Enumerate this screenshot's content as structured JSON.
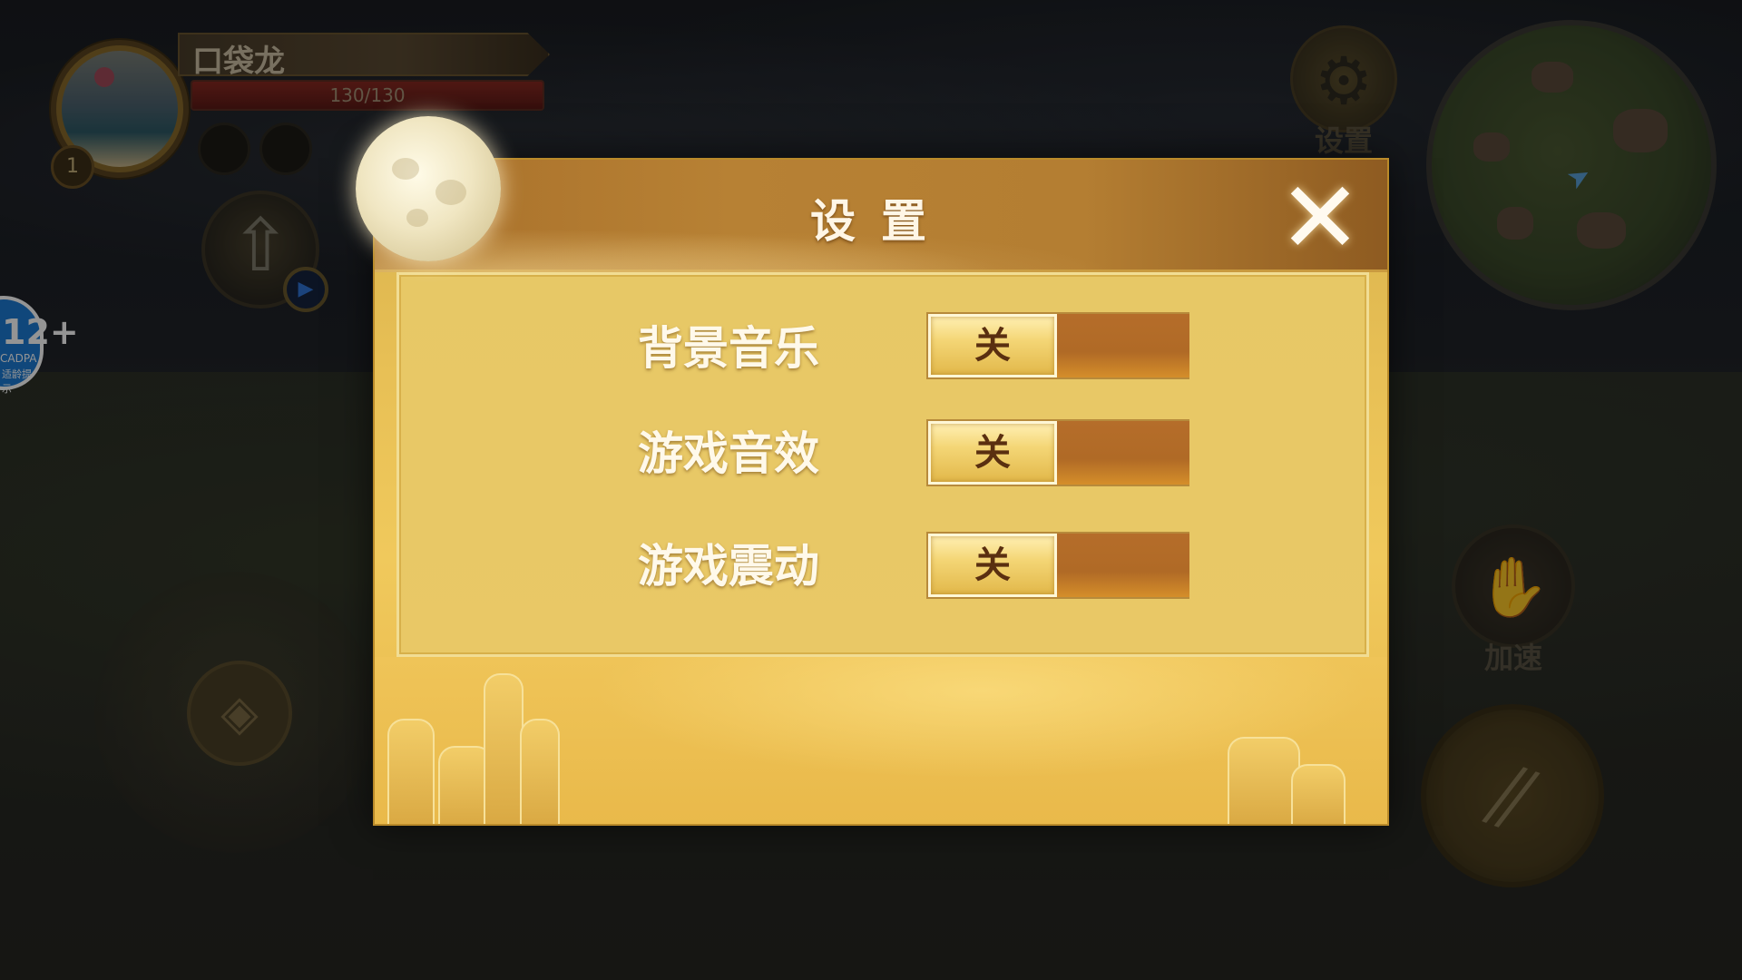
{
  "hud": {
    "player_name": "口袋龙",
    "hp_text": "130/130",
    "hp_fraction": 1.0,
    "level": "1",
    "settings_label": "设置",
    "speed_label": "加速"
  },
  "age_rating": {
    "value": "12+",
    "org": "CADPA",
    "caption": "适龄提示"
  },
  "modal": {
    "title": "设置",
    "close_icon": "close-x-icon"
  },
  "settings": [
    {
      "label": "背景音乐",
      "state_label": "关",
      "enabled": false
    },
    {
      "label": "游戏音效",
      "state_label": "关",
      "enabled": false
    },
    {
      "label": "游戏震动",
      "state_label": "关",
      "enabled": false
    }
  ],
  "colors": {
    "panel_gold": "#e7c866",
    "header_bronze": "#b47e32",
    "toggle_knob": "#f4d676",
    "toggle_track": "#b06a26",
    "label_text": "#fff9ea"
  }
}
